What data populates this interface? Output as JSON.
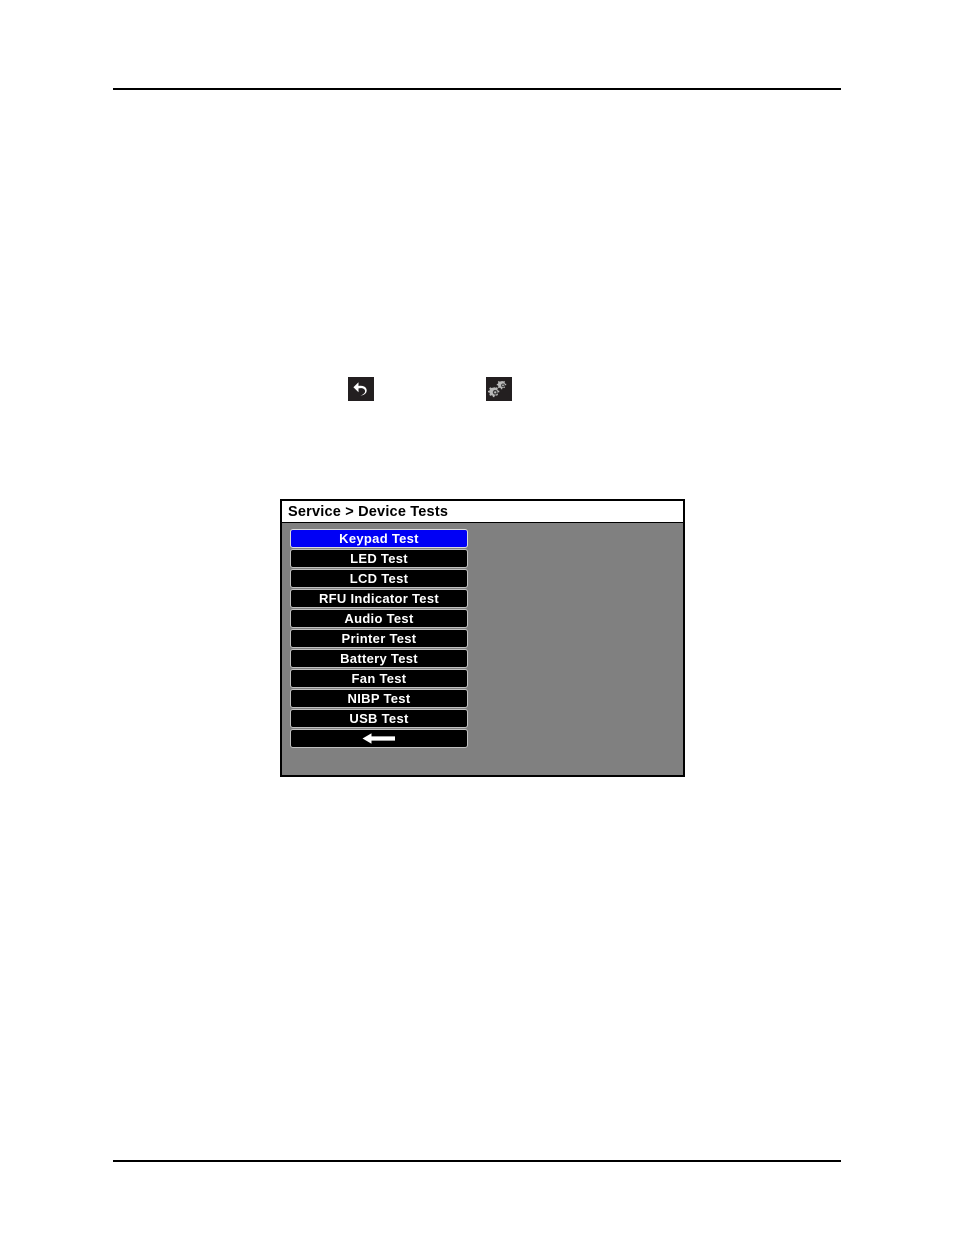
{
  "page": {
    "rules": [
      "top-rule",
      "bottom-rule"
    ]
  },
  "inline_icons": [
    {
      "name": "back-arrow-icon",
      "label": "Back"
    },
    {
      "name": "gears-settings-icon",
      "label": "Settings"
    }
  ],
  "device_screen": {
    "title": "Service > Device Tests",
    "background_color": "#808080",
    "selected_color": "#0000f5",
    "button_color": "#000000",
    "text_color": "#ffffff",
    "menu_items": [
      {
        "label": "Keypad Test",
        "selected": true
      },
      {
        "label": "LED Test",
        "selected": false
      },
      {
        "label": "LCD Test",
        "selected": false
      },
      {
        "label": "RFU Indicator Test",
        "selected": false
      },
      {
        "label": "Audio Test",
        "selected": false
      },
      {
        "label": "Printer Test",
        "selected": false
      },
      {
        "label": "Battery Test",
        "selected": false
      },
      {
        "label": "Fan Test",
        "selected": false
      },
      {
        "label": "NIBP Test",
        "selected": false
      },
      {
        "label": "USB Test",
        "selected": false
      }
    ],
    "back_button": {
      "icon": "left-arrow-icon",
      "label": ""
    }
  }
}
